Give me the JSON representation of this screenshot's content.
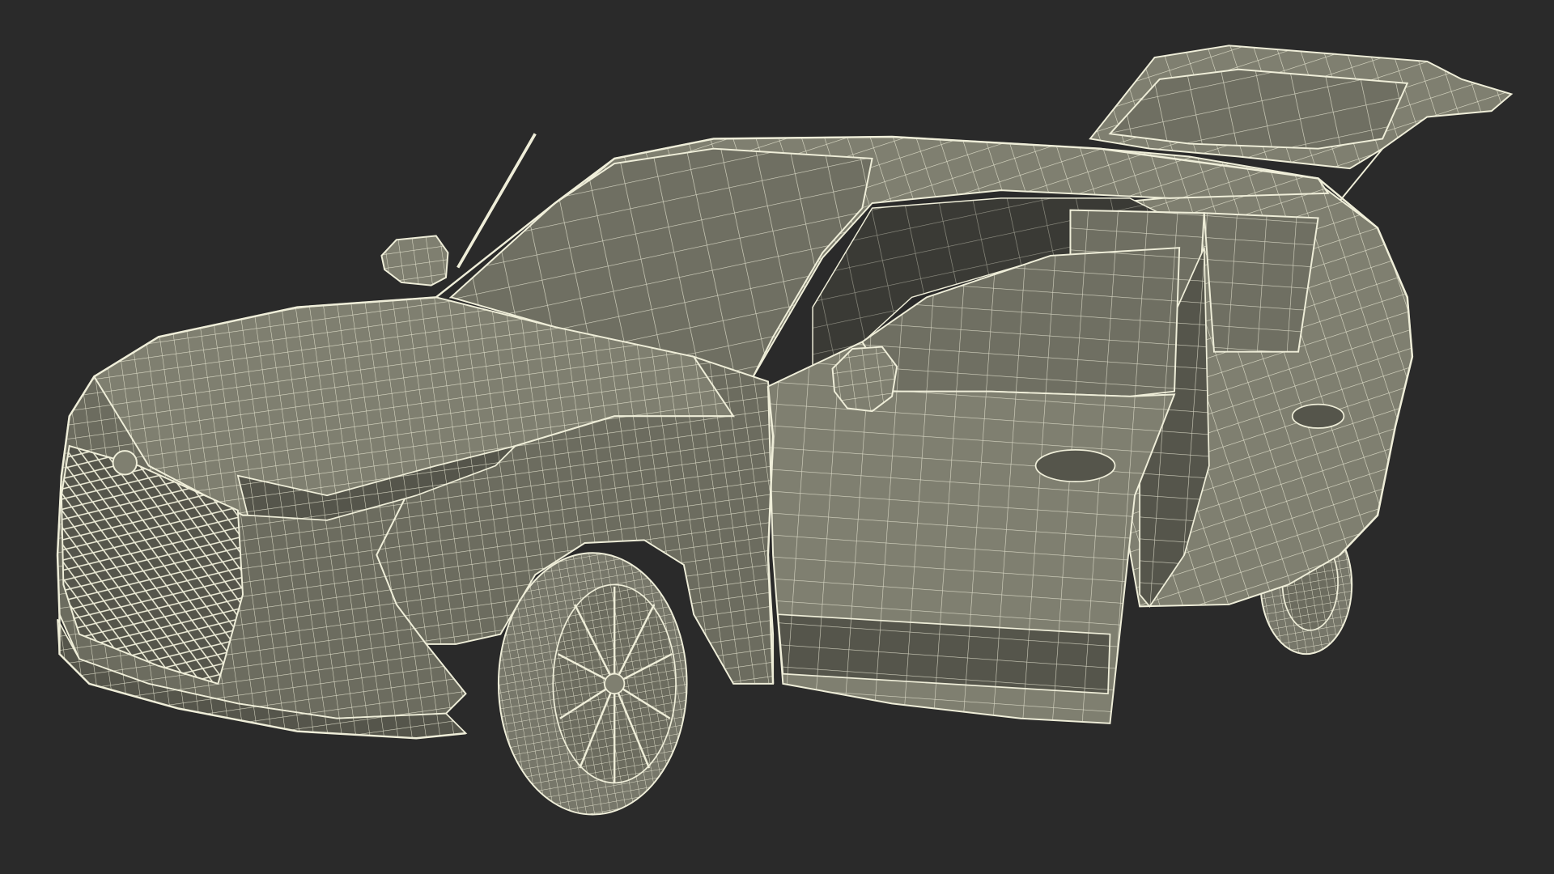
{
  "scene": {
    "subject": "suv-wireframe-render",
    "background_color": "#2a2a2a",
    "surface_color": "#7f7f70",
    "surface_shade_color": "#6c6c5f",
    "surface_dark_color": "#55554b",
    "wire_color": "#efeed9",
    "tire_color": "#77776a",
    "window_color": "#6f6f62",
    "interior_color": "#3a3a35"
  }
}
